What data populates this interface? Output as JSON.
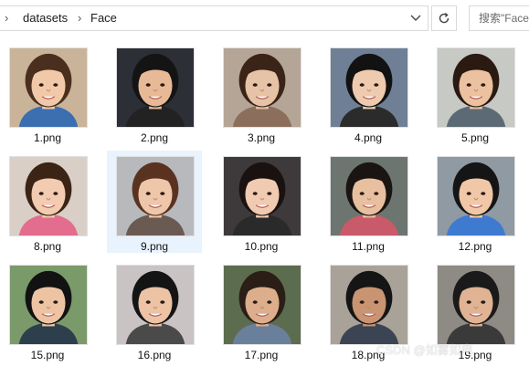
{
  "breadcrumb": {
    "items": [
      "datasets",
      "Face"
    ]
  },
  "search": {
    "placeholder": "搜索\"Face\""
  },
  "icons": {
    "chevron": "chevron-right-icon",
    "dropdown": "chevron-down-icon",
    "refresh": "refresh-icon"
  },
  "files": [
    {
      "name": "1.png",
      "bg": "#c9b49a",
      "skin": "#f1c9a8",
      "hair": "#4a2f1e",
      "shirt": "#3b6fb0",
      "selected": false
    },
    {
      "name": "2.png",
      "bg": "#2c2f35",
      "skin": "#e8b996",
      "hair": "#141414",
      "shirt": "#222222",
      "selected": false
    },
    {
      "name": "3.png",
      "bg": "#b5a596",
      "skin": "#e6c2a6",
      "hair": "#3a2418",
      "shirt": "#8b6f5c",
      "selected": false
    },
    {
      "name": "4.png",
      "bg": "#6f8096",
      "skin": "#eecaaf",
      "hair": "#121212",
      "shirt": "#2b2b2b",
      "selected": false
    },
    {
      "name": "5.png",
      "bg": "#c7c9c4",
      "skin": "#ebc1a0",
      "hair": "#2a1a12",
      "shirt": "#5c6a75",
      "selected": false
    },
    {
      "name": "8.png",
      "bg": "#d9cfc7",
      "skin": "#f2cbb0",
      "hair": "#3b2316",
      "shirt": "#e36d8f",
      "selected": false
    },
    {
      "name": "9.png",
      "bg": "#b7b9bd",
      "skin": "#eec6aa",
      "hair": "#5a3320",
      "shirt": "#6b5a52",
      "selected": true
    },
    {
      "name": "10.png",
      "bg": "#3e3a3c",
      "skin": "#f0cbb1",
      "hair": "#1a1210",
      "shirt": "#2a2a2a",
      "selected": false
    },
    {
      "name": "11.png",
      "bg": "#6d7570",
      "skin": "#e8bf9f",
      "hair": "#1a1512",
      "shirt": "#c85a6a",
      "selected": false
    },
    {
      "name": "12.png",
      "bg": "#8f9aa2",
      "skin": "#f0c8a8",
      "hair": "#151515",
      "shirt": "#3f7ad1",
      "selected": false
    },
    {
      "name": "15.png",
      "bg": "#7a9a6a",
      "skin": "#ecc4a4",
      "hair": "#121212",
      "shirt": "#2d3e4c",
      "selected": false
    },
    {
      "name": "16.png",
      "bg": "#c9c3c4",
      "skin": "#ecc3a5",
      "hair": "#141414",
      "shirt": "#4a4a4a",
      "selected": false
    },
    {
      "name": "17.png",
      "bg": "#5c6c4e",
      "skin": "#dcae8c",
      "hair": "#2a1e16",
      "shirt": "#6a7f9a",
      "selected": false
    },
    {
      "name": "18.png",
      "bg": "#a9a298",
      "skin": "#c99472",
      "hair": "#151515",
      "shirt": "#3b4452",
      "selected": false
    },
    {
      "name": "19.png",
      "bg": "#8e8a84",
      "skin": "#dfb394",
      "hair": "#1a1a1a",
      "shirt": "#3a3a3a",
      "selected": false
    }
  ],
  "watermark": "CSDN @如雾如电"
}
